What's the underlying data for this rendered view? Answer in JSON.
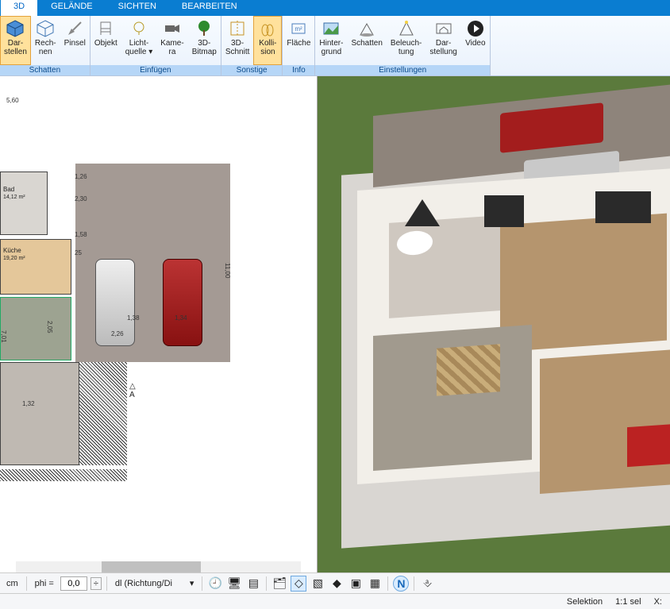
{
  "menubar": {
    "tabs": [
      "3D",
      "GELÄNDE",
      "SICHTEN",
      "BEARBEITEN"
    ],
    "active": 0
  },
  "ribbon": {
    "groups": [
      {
        "label": "Schatten",
        "items": [
          {
            "name": "darstellen",
            "label": "Dar-\nstellen",
            "icon": "cube-icon",
            "active": true
          },
          {
            "name": "rechnen",
            "label": "Rech-\nnen",
            "icon": "cube-wire-icon"
          },
          {
            "name": "pinsel",
            "label": "Pinsel",
            "icon": "brush-icon"
          }
        ]
      },
      {
        "label": "Einfügen",
        "items": [
          {
            "name": "objekt",
            "label": "Objekt",
            "icon": "chair-icon"
          },
          {
            "name": "lichtquelle",
            "label": "Licht-\nquelle ▾",
            "icon": "bulb-icon"
          },
          {
            "name": "kamera",
            "label": "Kame-\nra",
            "icon": "camera-icon"
          },
          {
            "name": "3dbitmap",
            "label": "3D-\nBitmap",
            "icon": "tree-icon"
          }
        ]
      },
      {
        "label": "Sonstige",
        "items": [
          {
            "name": "3dschnitt",
            "label": "3D-\nSchnitt",
            "icon": "section-icon"
          },
          {
            "name": "kollision",
            "label": "Kolli-\nsion",
            "icon": "collision-icon",
            "active": true
          }
        ]
      },
      {
        "label": "Info",
        "items": [
          {
            "name": "flaeche",
            "label": "Fläche",
            "icon": "area-icon"
          }
        ]
      },
      {
        "label": "Einstellungen",
        "items": [
          {
            "name": "hintergrund",
            "label": "Hinter-\ngrund",
            "icon": "bg-icon"
          },
          {
            "name": "schatten2",
            "label": "Schatten",
            "icon": "shadow-icon"
          },
          {
            "name": "beleuchtung",
            "label": "Beleuch-\ntung",
            "icon": "light-icon"
          },
          {
            "name": "darstellung",
            "label": "Dar-\nstellung",
            "icon": "display-icon"
          },
          {
            "name": "video",
            "label": "Video",
            "icon": "play-icon"
          }
        ]
      }
    ]
  },
  "plan": {
    "topdim": "5,60",
    "rooms": [
      {
        "name": "Bad",
        "area": "14,12 m²"
      },
      {
        "name": "Küche",
        "area": "19,20 m²"
      }
    ],
    "dims": [
      "1,26",
      "2,30",
      "1,58",
      "25",
      "11,00",
      "2,26",
      "1,38",
      "1,34",
      "2,05",
      "7,01",
      "1,32"
    ],
    "section_marker": "A"
  },
  "bottombar": {
    "unit": "cm",
    "phi_label": "phi =",
    "phi_value": "0,0",
    "phi_step": "÷",
    "dl_label": "dl (Richtung/Di",
    "iconbuttons": [
      "clock",
      "screen",
      "stack",
      "layers",
      "snap-angle",
      "snap-grid",
      "diamond",
      "snap-object",
      "grid",
      "nord",
      "marker"
    ]
  },
  "statusbar": {
    "selektion": "Selektion",
    "scale": "1:1 sel",
    "xlabel": "X:"
  },
  "icons": {
    "cube": "⬣",
    "brush": "🖌",
    "chair": "🪑",
    "bulb": "💡",
    "camera": "🎥",
    "tree": "🌳",
    "section": "✂",
    "collision": "⇅",
    "area": "▭",
    "bg": "☁",
    "shadow": "◢",
    "light": "✦",
    "display": "⌂",
    "play": "▶",
    "clock": "🕘",
    "screen": "🖥",
    "stack": "▤",
    "layers": "🗂",
    "nord": "N"
  }
}
